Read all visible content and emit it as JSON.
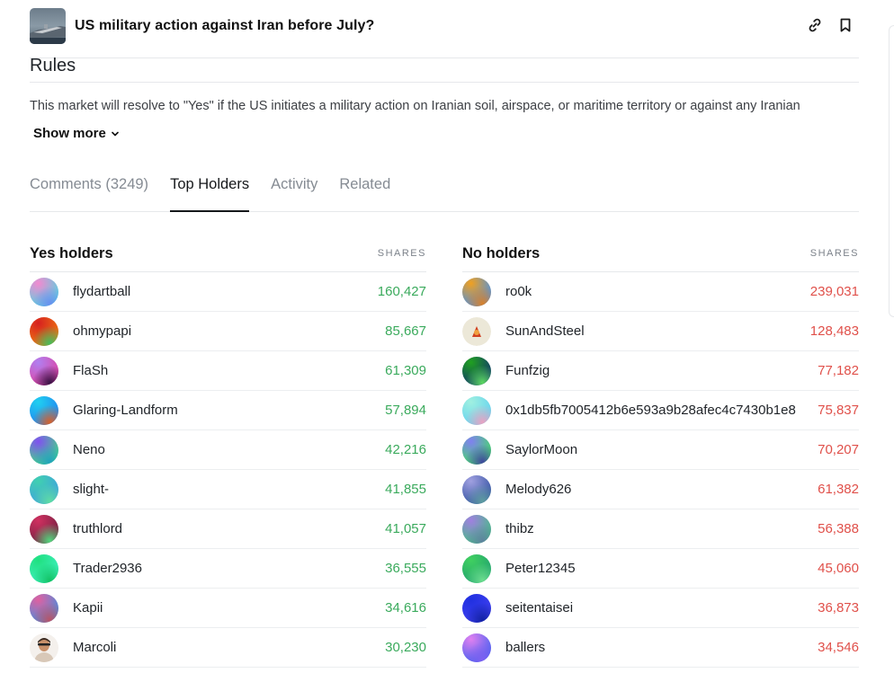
{
  "header": {
    "title": "US military action against Iran before July?",
    "link_icon": "link-icon",
    "bookmark_icon": "bookmark-icon"
  },
  "rules": {
    "heading": "Rules",
    "text": "This market will resolve to \"Yes\" if the US initiates a military action on Iranian soil, airspace, or maritime territory or against any Iranian",
    "show_more": "Show more"
  },
  "tabs": [
    {
      "label": "Comments (3249)",
      "active": false
    },
    {
      "label": "Top Holders",
      "active": true
    },
    {
      "label": "Activity",
      "active": false
    },
    {
      "label": "Related",
      "active": false
    }
  ],
  "yes_holders": {
    "title": "Yes holders",
    "shares_label": "SHARES",
    "rows": [
      {
        "name": "flydartball",
        "shares": "160,427",
        "colors": [
          "#f28ad0",
          "#4fd6e0",
          "#6a8cf0"
        ]
      },
      {
        "name": "ohmypapi",
        "shares": "85,667",
        "colors": [
          "#d62020",
          "#f07c10",
          "#3cc060"
        ]
      },
      {
        "name": "FlaSh",
        "shares": "61,309",
        "colors": [
          "#b080f0",
          "#e040a0",
          "#301040"
        ]
      },
      {
        "name": "Glaring-Landform",
        "shares": "57,894",
        "colors": [
          "#20d0f0",
          "#2080f0",
          "#e06020"
        ]
      },
      {
        "name": "Neno",
        "shares": "42,216",
        "colors": [
          "#8050f0",
          "#40e080",
          "#20a0c0"
        ]
      },
      {
        "name": "slight-",
        "shares": "41,855",
        "colors": [
          "#40d0b0",
          "#40a0e0",
          "#60e0a0"
        ]
      },
      {
        "name": "truthlord",
        "shares": "41,057",
        "colors": [
          "#d03060",
          "#702040",
          "#50e080"
        ]
      },
      {
        "name": "Trader2936",
        "shares": "36,555",
        "colors": [
          "#20e080",
          "#40f0c0",
          "#10c060"
        ]
      },
      {
        "name": "Kapii",
        "shares": "34,616",
        "colors": [
          "#e060a0",
          "#4090e0",
          "#c05060"
        ]
      },
      {
        "name": "Marcoli",
        "shares": "30,230",
        "colors": [
          "#c89070",
          "#f0e0d0",
          "#402020"
        ]
      }
    ]
  },
  "no_holders": {
    "title": "No holders",
    "shares_label": "SHARES",
    "rows": [
      {
        "name": "ro0k",
        "shares": "239,031",
        "colors": [
          "#f0a020",
          "#4090f0",
          "#e08020"
        ]
      },
      {
        "name": "SunAndSteel",
        "shares": "128,483",
        "colors": [
          "#f0f0e0",
          "#e0e0c0",
          "#c03020"
        ]
      },
      {
        "name": "Funfzig",
        "shares": "77,182",
        "colors": [
          "#20a020",
          "#103070",
          "#60e060"
        ]
      },
      {
        "name": "0x1db5fb7005412b6e593a9b28afec4c7430b1e8",
        "shares": "75,837",
        "colors": [
          "#a0f0e0",
          "#60d0f0",
          "#f0a0c0"
        ]
      },
      {
        "name": "SaylorMoon",
        "shares": "70,207",
        "colors": [
          "#8080f0",
          "#40e060",
          "#4040a0"
        ]
      },
      {
        "name": "Melody626",
        "shares": "61,382",
        "colors": [
          "#a0a0e0",
          "#3050a0",
          "#60a0a0"
        ]
      },
      {
        "name": "thibz",
        "shares": "56,388",
        "colors": [
          "#a080e0",
          "#40c080",
          "#6080a0"
        ]
      },
      {
        "name": "Peter12345",
        "shares": "45,060",
        "colors": [
          "#40d060",
          "#20a070",
          "#70e090"
        ]
      },
      {
        "name": "seitentaisei",
        "shares": "36,873",
        "colors": [
          "#2030e0",
          "#4040f0",
          "#1020a0"
        ]
      },
      {
        "name": "ballers",
        "shares": "34,546",
        "colors": [
          "#e080f0",
          "#4060f0",
          "#8060f0"
        ]
      }
    ]
  }
}
